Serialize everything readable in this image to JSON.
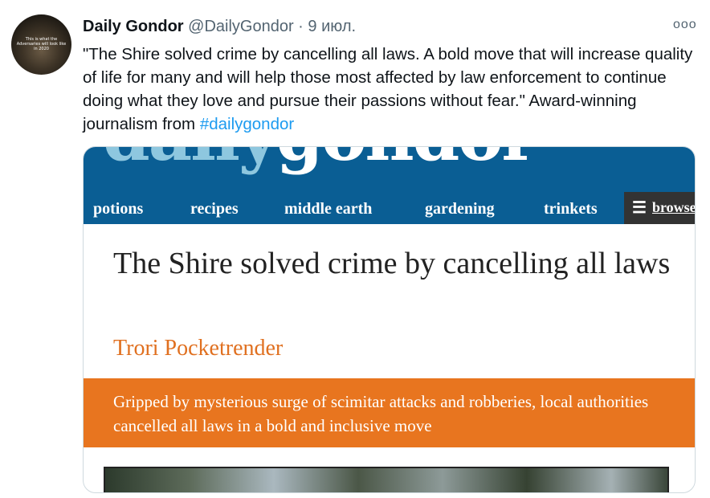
{
  "tweet": {
    "avatar_caption": "This is what the Adversaries will look like in 2020",
    "author_name": "Daily Gondor",
    "handle": "@DailyGondor",
    "separator": "·",
    "date": "9 июл.",
    "more_icon": "ooo",
    "text": "\"The Shire solved crime by cancelling all laws. A bold move that will increase quality of life for many and will help those most affected by law enforcement to continue doing what they love and pursue their passions without fear.\" Award-winning journalism from ",
    "hashtag": "#dailygondor"
  },
  "card": {
    "logo_part1": "daily",
    "logo_part2": "gondor",
    "nav": [
      "potions",
      "recipes",
      "middle earth",
      "gardening",
      "trinkets"
    ],
    "browse_icon": "menu-icon",
    "browse_label": "browse",
    "headline": "The Shire solved crime by cancelling all laws",
    "author": "Trori Pocketrender",
    "standfirst": "Gripped by mysterious surge of scimitar attacks and robberies, local authorities cancelled all laws in a bold and inclusive move"
  }
}
